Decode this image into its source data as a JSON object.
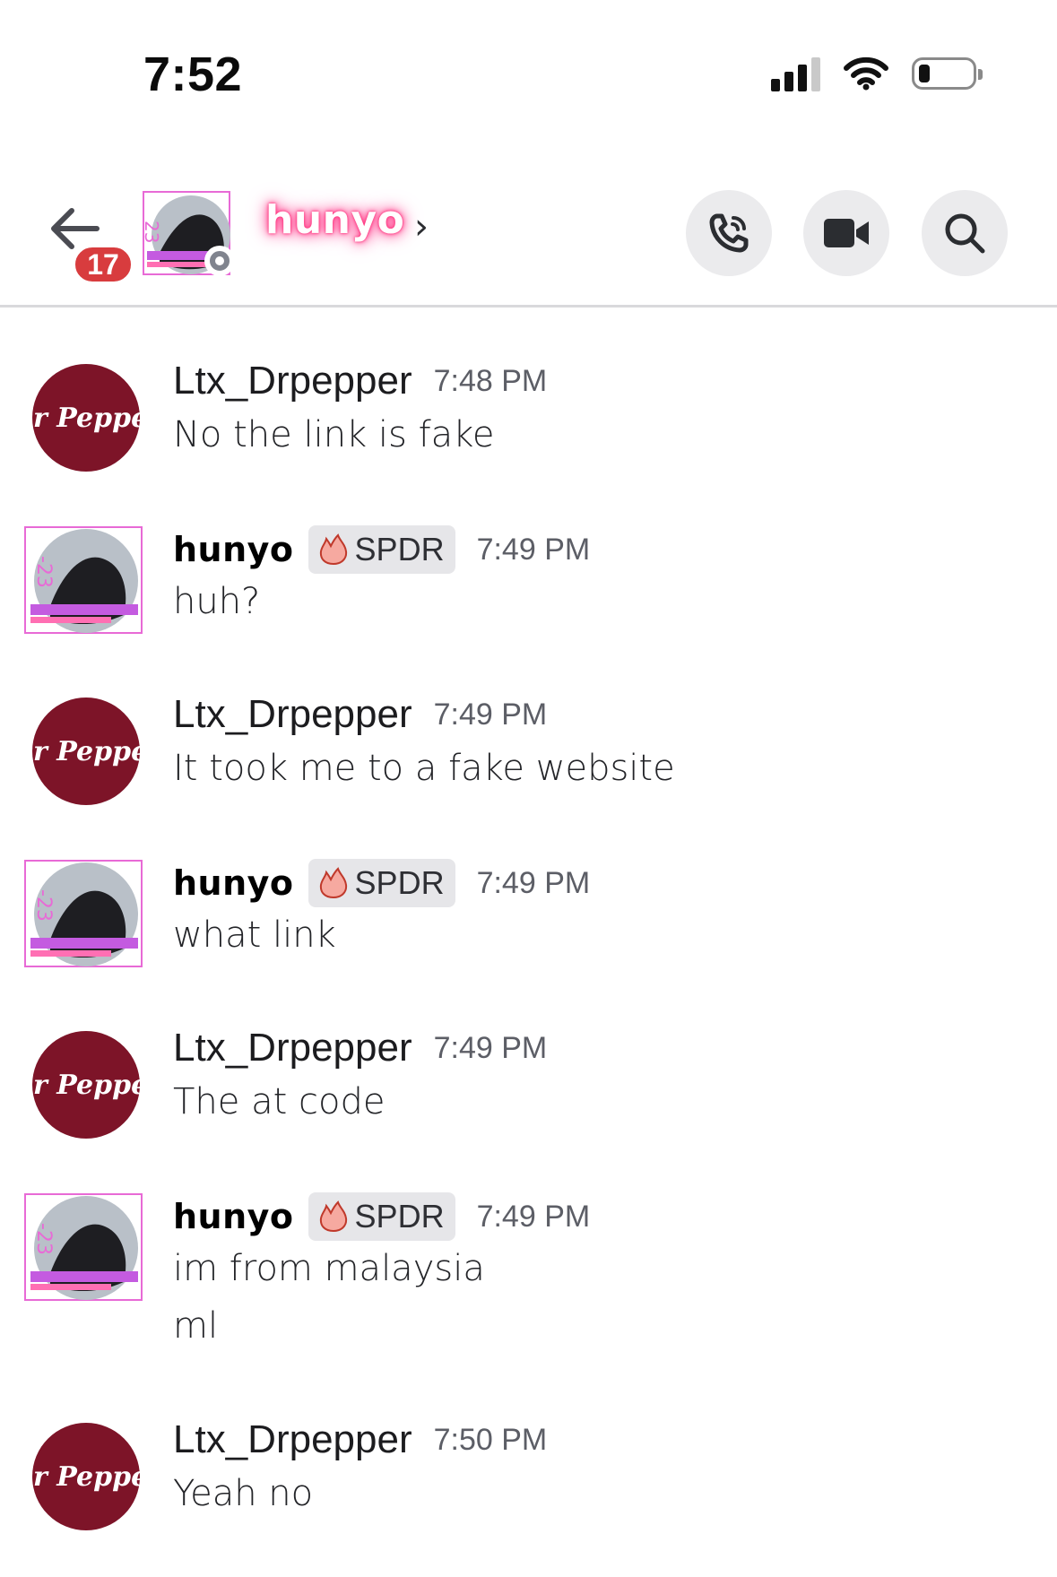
{
  "status_bar": {
    "time": "7:52"
  },
  "header": {
    "back_icon": "arrow-left-icon",
    "unread_count": "17",
    "channel_name": "hunyo",
    "chevron": "›",
    "actions": [
      {
        "name": "call-button",
        "icon": "phone-icon"
      },
      {
        "name": "video-button",
        "icon": "video-camera-icon"
      },
      {
        "name": "search-button",
        "icon": "search-icon"
      }
    ]
  },
  "messages": [
    {
      "author": "Ltx_Drpepper",
      "time": "7:48 PM",
      "lines": [
        "No the link is fake"
      ]
    },
    {
      "author": "hunyo",
      "tag": "SPDR",
      "time": "7:49 PM",
      "lines": [
        "huh?"
      ]
    },
    {
      "author": "Ltx_Drpepper",
      "time": "7:49 PM",
      "lines": [
        "It took me to a fake website"
      ]
    },
    {
      "author": "hunyo",
      "tag": "SPDR",
      "time": "7:49 PM",
      "lines": [
        "what link"
      ]
    },
    {
      "author": "Ltx_Drpepper",
      "time": "7:49 PM",
      "lines": [
        "The at code"
      ]
    },
    {
      "author": "hunyo",
      "tag": "SPDR",
      "time": "7:49 PM",
      "lines": [
        "im from malaysia",
        "ml"
      ]
    },
    {
      "author": "Ltx_Drpepper",
      "time": "7:50 PM",
      "lines": [
        "Yeah no"
      ]
    }
  ],
  "avatars": {
    "drpepper": {
      "logo_text": "Dr Pepper",
      "color": "#7d1428"
    }
  },
  "colors": {
    "unread_badge": "#d83c3e",
    "name_glow": "#ff2e7a",
    "drpepper": "#7d1428"
  }
}
